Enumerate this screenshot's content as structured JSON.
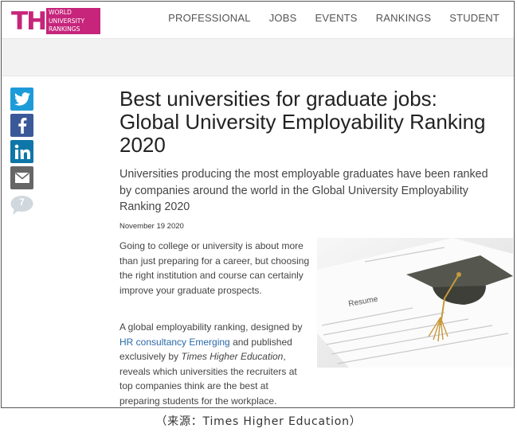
{
  "logo": {
    "the": "THE",
    "line1": "WORLD",
    "line2": "UNIVERSITY",
    "line3": "RANKINGS"
  },
  "nav": [
    "PROFESSIONAL",
    "JOBS",
    "EVENTS",
    "RANKINGS",
    "STUDENT"
  ],
  "share": {
    "comment_count": "7"
  },
  "article": {
    "title": "Best universities for graduate jobs: Global University Employability Ranking 2020",
    "subtitle": "Universities producing the most employable graduates have been ranked by companies around the world in the Global University Employability Ranking 2020",
    "date": "November 19 2020",
    "p1": "Going to college or university is about more than just preparing for a career, but choosing the right institution and course can certainly improve your graduate prospects.",
    "p2_a": "A global employability ranking, designed by ",
    "p2_link": "HR consultancy Emerging",
    "p2_b": " and published exclusively by ",
    "p2_em": "Times Higher Education",
    "p2_c": ", reveals which universities the recruiters at top companies think are the best at preparing students for the workplace.",
    "image_label": "Resume"
  },
  "caption": "（来源：Times Higher Education）",
  "colors": {
    "brand": "#c6257b",
    "twitter": "#1d9bd8",
    "facebook": "#3b5998",
    "linkedin": "#0e76a8",
    "link": "#2a6aa8"
  }
}
